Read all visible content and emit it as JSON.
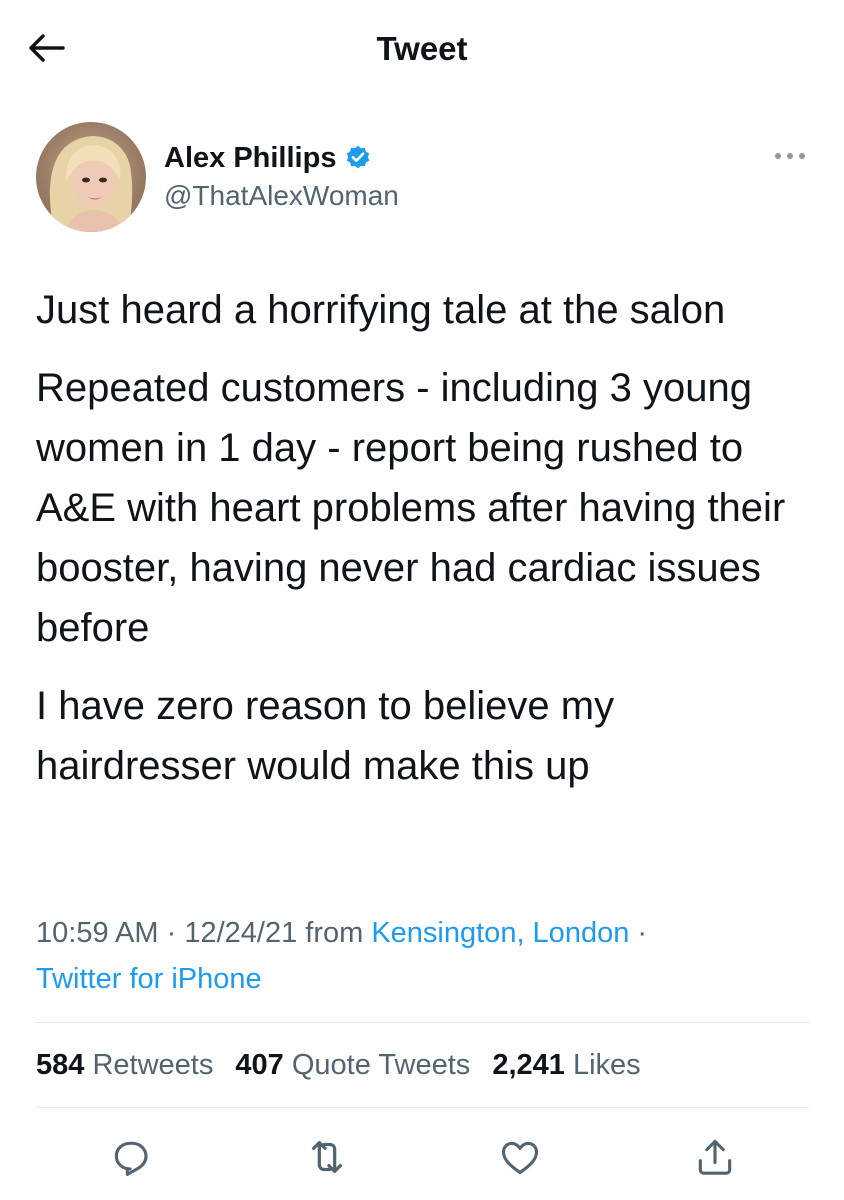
{
  "header": {
    "title": "Tweet",
    "back_icon": "arrow-left-icon"
  },
  "author": {
    "name": "Alex Phillips",
    "handle": "@ThatAlexWoman",
    "verified": true,
    "verified_color": "#1d9bf0"
  },
  "tweet": {
    "paragraphs": [
      "Just heard a horrifying tale at the salon",
      "Repeated customers - including 3 young women in 1 day - report being rushed to A&E with heart problems after having their booster, having never had cardiac issues before",
      "I have zero reason to believe my hairdresser would make this up"
    ]
  },
  "meta": {
    "time": "10:59 AM",
    "separator": " · ",
    "date": "12/24/21",
    "from_label": " from ",
    "location": "Kensington, London",
    "trailing_separator": " ·",
    "source": "Twitter for iPhone"
  },
  "stats": {
    "retweets_count": "584",
    "retweets_label": " Retweets",
    "quotes_count": "407",
    "quotes_label": " Quote Tweets",
    "likes_count": "2,241",
    "likes_label": " Likes"
  },
  "actions": [
    "reply-icon",
    "retweet-icon",
    "like-icon",
    "share-icon"
  ],
  "colors": {
    "text": "#0f1419",
    "secondary": "#536471",
    "link": "#1d9bf0",
    "divider": "#e1e6ea"
  }
}
